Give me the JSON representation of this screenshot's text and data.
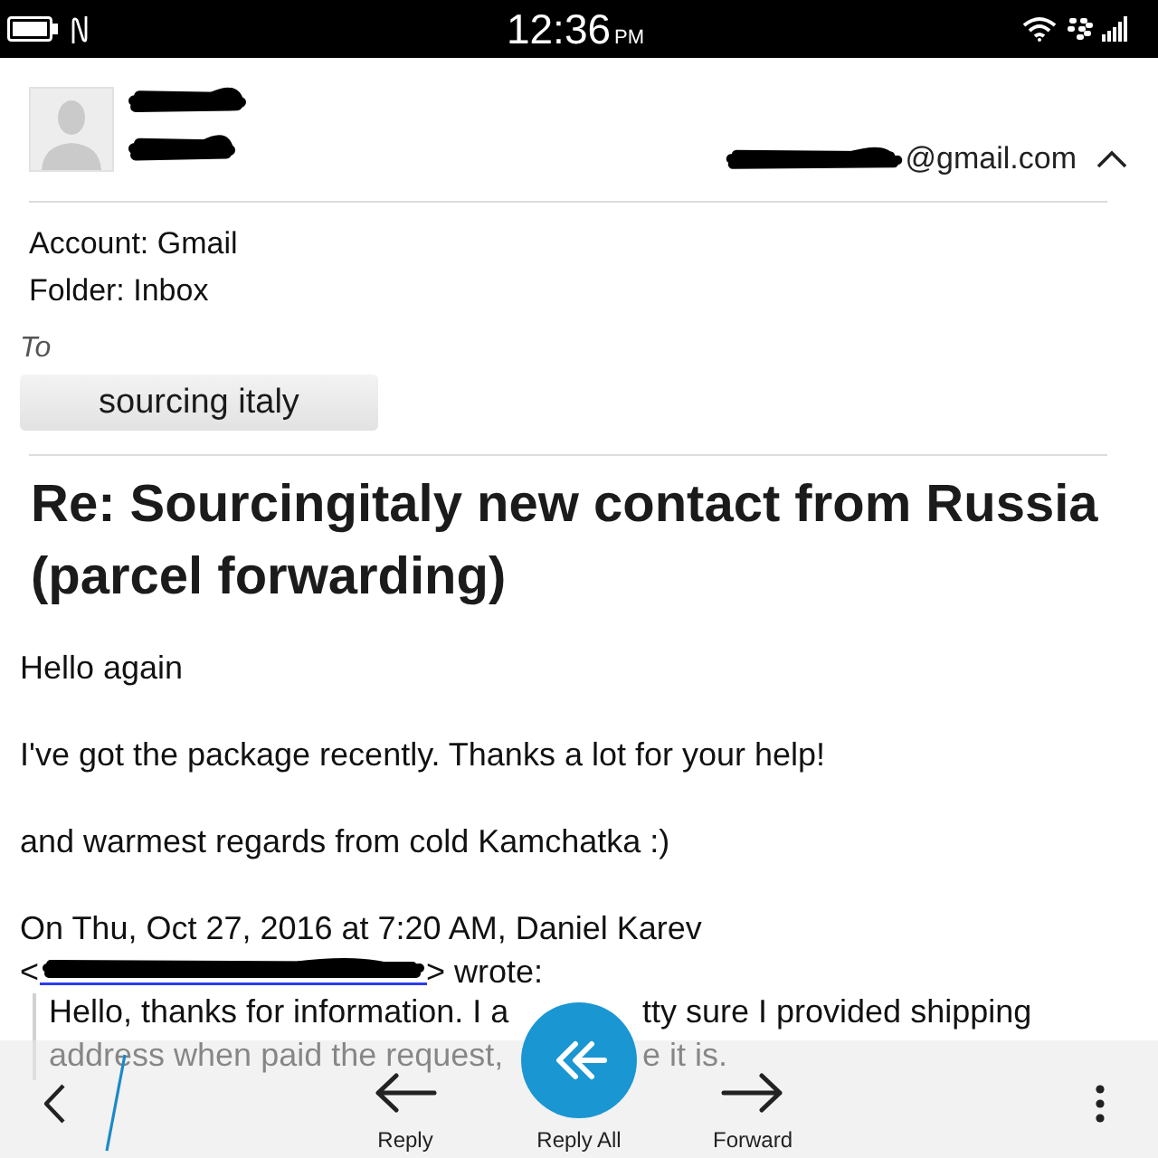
{
  "status_bar": {
    "time": "12:36",
    "time_suffix": "PM"
  },
  "header": {
    "sender_email": "@gmail.com",
    "details_expanded": true
  },
  "meta": {
    "account": "Account: Gmail",
    "folder": "Folder: Inbox"
  },
  "recipients": {
    "label": "To",
    "chips": [
      "sourcing italy"
    ]
  },
  "subject": "Re: Sourcingitaly new contact from Russia (parcel forwarding)",
  "body": {
    "paragraphs": [
      "Hello again",
      "I've got the package recently. Thanks a lot for your help!",
      "and warmest regards from cold Kamchatka :)"
    ],
    "attribution": "On Thu, Oct 27, 2016 at 7:20 AM, Daniel Karev",
    "attribution_open": "<",
    "attribution_close": "> wrote:",
    "quote_lines": [
      {
        "before": "Hello, thanks for information. I a",
        "after": "tty sure I provided shipping"
      },
      {
        "before": "address when paid the request,",
        "after": "e it is."
      }
    ]
  },
  "toolbar": {
    "actions": [
      {
        "kind": "reply",
        "label": "Reply"
      },
      {
        "kind": "reply_all",
        "label": "Reply All"
      },
      {
        "kind": "forward",
        "label": "Forward"
      }
    ]
  }
}
